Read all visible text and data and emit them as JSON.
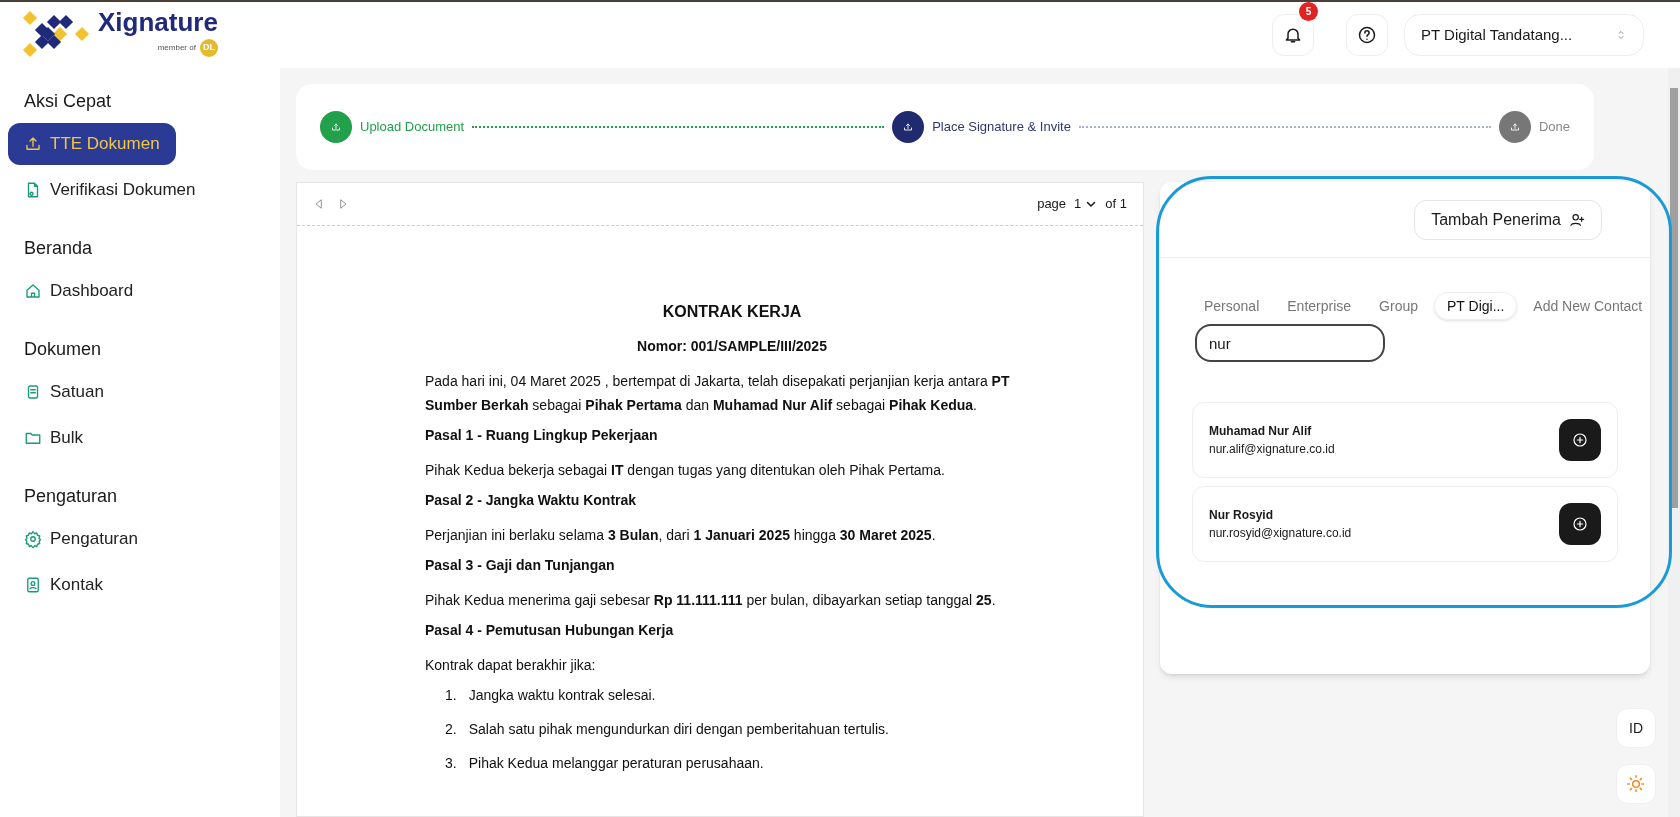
{
  "brand": {
    "name": "Xignature",
    "tagline": "member of",
    "badge": "DL"
  },
  "header": {
    "notifications": "5",
    "organization": "PT Digital Tandatang..."
  },
  "sidebar": [
    {
      "title": "Aksi Cepat",
      "items": [
        {
          "label": "TTE Dokumen",
          "selected": true
        },
        {
          "label": "Verifikasi Dokumen",
          "selected": false
        }
      ]
    },
    {
      "title": "Beranda",
      "items": [
        {
          "label": "Dashboard",
          "selected": false
        }
      ]
    },
    {
      "title": "Dokumen",
      "items": [
        {
          "label": "Satuan",
          "selected": false
        },
        {
          "label": "Bulk",
          "selected": false
        }
      ]
    },
    {
      "title": "Pengaturan",
      "items": [
        {
          "label": "Pengaturan",
          "selected": false
        },
        {
          "label": "Kontak",
          "selected": false
        }
      ]
    }
  ],
  "stepper": [
    {
      "label": "Upload Document",
      "completed": true,
      "active": false
    },
    {
      "label": "Place Signature & Invite",
      "completed": false,
      "active": true
    },
    {
      "label": "Done",
      "completed": false,
      "active": false
    }
  ],
  "viewer": {
    "page_label": "page",
    "page": "1",
    "of": "of 1"
  },
  "document": {
    "title": "KONTRAK KERJA",
    "number": "Nomor: 001/SAMPLE/III/2025",
    "blocks": [
      {
        "kind": "para",
        "text": "Pada hari ini, 04 Maret 2025 , bertempat di Jakarta, telah disepakati perjanjian kerja antara **PT Sumber Berkah** sebagai **Pihak Pertama** dan **Muhamad Nur Alif** sebagai **Pihak Kedua**."
      },
      {
        "kind": "heading",
        "text": "Pasal 1 - Ruang Lingkup Pekerjaan"
      },
      {
        "kind": "para",
        "text": "Pihak Kedua bekerja sebagai **IT** dengan tugas yang ditentukan oleh Pihak Pertama."
      },
      {
        "kind": "heading",
        "text": "Pasal 2 - Jangka Waktu Kontrak"
      },
      {
        "kind": "para",
        "text": "Perjanjian ini berlaku selama **3 Bulan**, dari **1 Januari 2025** hingga **30 Maret 2025**."
      },
      {
        "kind": "heading",
        "text": "Pasal 3 - Gaji dan Tunjangan"
      },
      {
        "kind": "para",
        "text": "Pihak Kedua menerima gaji sebesar **Rp 11.111.111** per bulan, dibayarkan setiap tanggal **25**."
      },
      {
        "kind": "heading",
        "text": "Pasal 4 - Pemutusan Hubungan Kerja"
      },
      {
        "kind": "para",
        "text": "Kontrak dapat berakhir jika:"
      },
      {
        "kind": "item",
        "number": "1.",
        "text": "Jangka waktu kontrak selesai."
      },
      {
        "kind": "item",
        "number": "2.",
        "text": "Salah satu pihak mengundurkan diri dengan pemberitahuan tertulis."
      },
      {
        "kind": "item",
        "number": "3.",
        "text": "Pihak Kedua melanggar peraturan perusahaan."
      }
    ]
  },
  "recipients": {
    "add_button": "Tambah Penerima",
    "tabs": [
      {
        "label": "Personal",
        "selected": false
      },
      {
        "label": "Enterprise",
        "selected": false
      },
      {
        "label": "Group",
        "selected": false
      },
      {
        "label": "PT Digi...",
        "selected": true
      },
      {
        "label": "Add New Contact",
        "selected": false
      }
    ],
    "search": {
      "value": "nur"
    },
    "contacts": [
      {
        "name": "Muhamad Nur Alif",
        "email": "nur.alif@xignature.co.id"
      },
      {
        "name": "Nur Rosyid",
        "email": "nur.rosyid@xignature.co.id"
      }
    ]
  },
  "language": "ID"
}
